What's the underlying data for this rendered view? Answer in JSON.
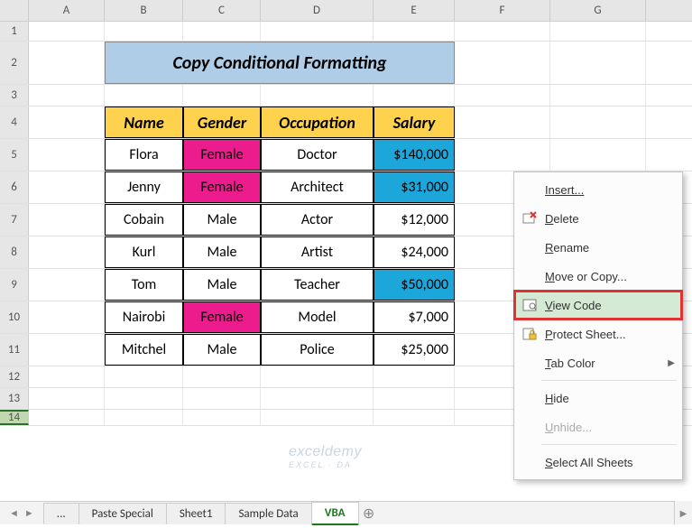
{
  "columns": [
    "A",
    "B",
    "C",
    "D",
    "E",
    "F",
    "G"
  ],
  "row_numbers": [
    1,
    2,
    3,
    4,
    5,
    6,
    7,
    8,
    9,
    10,
    11,
    12,
    13,
    14
  ],
  "title": "Copy Conditional Formatting",
  "headers": {
    "name": "Name",
    "gender": "Gender",
    "occupation": "Occupation",
    "salary": "Salary"
  },
  "rows": [
    {
      "name": "Flora",
      "gender": "Female",
      "occupation": "Doctor",
      "salary": "$140,000",
      "gender_hl": true,
      "salary_hl": true
    },
    {
      "name": "Jenny",
      "gender": "Female",
      "occupation": "Architect",
      "salary": "$31,000",
      "gender_hl": true,
      "salary_hl": true
    },
    {
      "name": "Cobain",
      "gender": "Male",
      "occupation": "Actor",
      "salary": "$12,000",
      "gender_hl": false,
      "salary_hl": false
    },
    {
      "name": "Kurl",
      "gender": "Male",
      "occupation": "Artist",
      "salary": "$24,000",
      "gender_hl": false,
      "salary_hl": false
    },
    {
      "name": "Tom",
      "gender": "Male",
      "occupation": "Teacher",
      "salary": "$50,000",
      "gender_hl": false,
      "salary_hl": true
    },
    {
      "name": "Nairobi",
      "gender": "Female",
      "occupation": "Model",
      "salary": "$7,000",
      "gender_hl": true,
      "salary_hl": false
    },
    {
      "name": "Mitchel",
      "gender": "Male",
      "occupation": "Police",
      "salary": "$25,000",
      "gender_hl": false,
      "salary_hl": false
    }
  ],
  "context_menu": {
    "insert": "Insert...",
    "delete": "Delete",
    "rename": "Rename",
    "move": "Move or Copy...",
    "view_code": "View Code",
    "protect": "Protect Sheet...",
    "tab_color": "Tab Color",
    "hide": "Hide",
    "unhide": "Unhide...",
    "select_all": "Select All Sheets"
  },
  "tabs": {
    "dots": "...",
    "paste": "Paste Special",
    "sheet1": "Sheet1",
    "sample": "Sample Data",
    "vba": "VBA"
  },
  "watermark": "exceldemy",
  "watermark_sub": "EXCEL · DA"
}
